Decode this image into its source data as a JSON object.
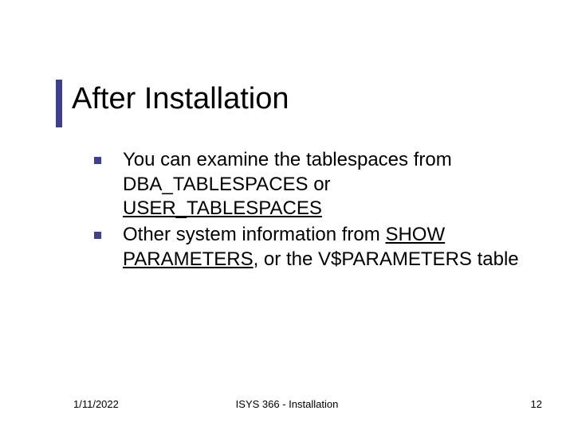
{
  "title": "After Installation",
  "bullets": [
    {
      "pre": "You can examine the tablespaces from DBA_TABLESPACES or ",
      "link": "USER_TABLESPACES",
      "post": ""
    },
    {
      "pre": "Other system information from ",
      "link": "SHOW PARAMETERS",
      "post": ", or the V$PARAMETERS table"
    }
  ],
  "footer": {
    "date": "1/11/2022",
    "course": "ISYS 366 - Installation",
    "page": "12"
  }
}
